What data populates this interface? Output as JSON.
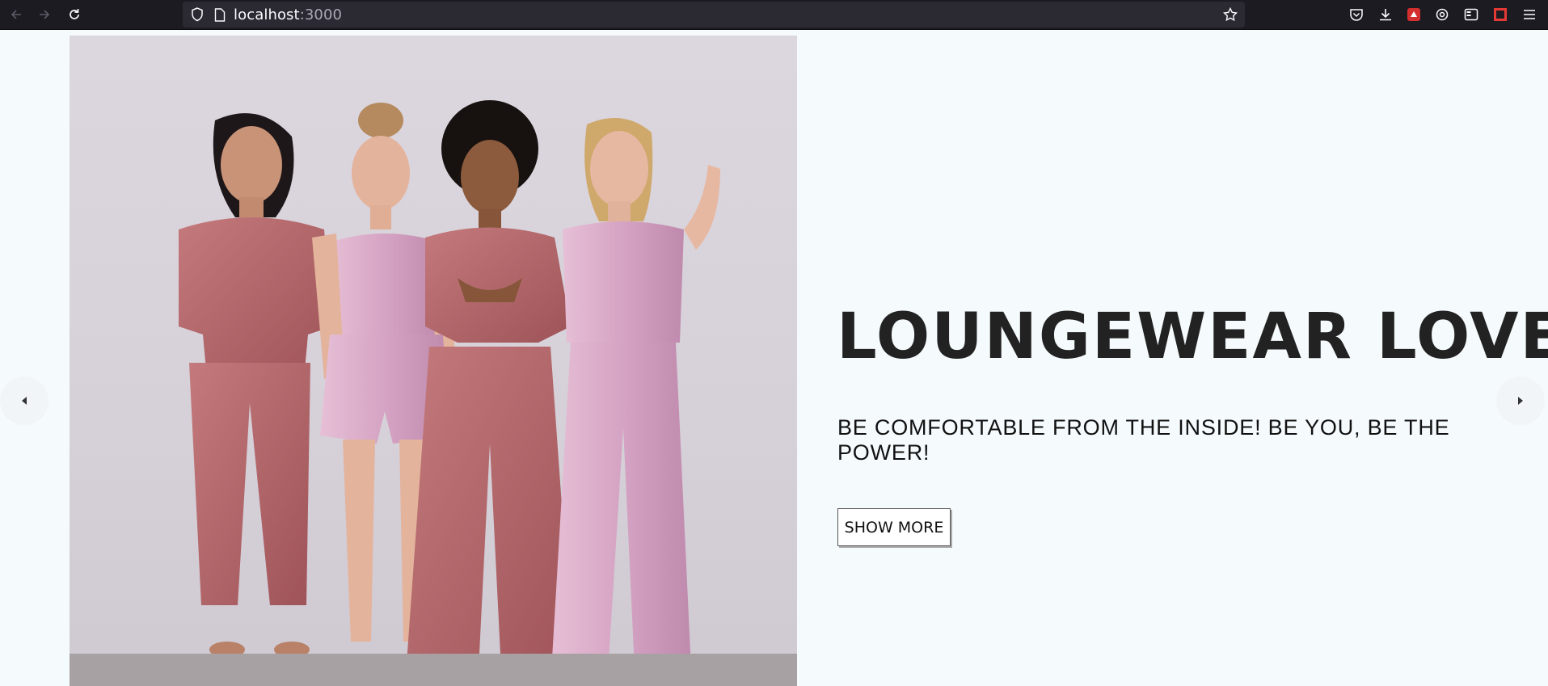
{
  "browser": {
    "url_host": "localhost",
    "url_port": ":3000",
    "icons": [
      "back-icon",
      "forward-icon",
      "reload-icon",
      "shield-icon",
      "page-icon",
      "bookmark-star-icon",
      "pocket-icon",
      "download-icon",
      "extension-icon",
      "sync-icon",
      "sidebar-icon",
      "extension-red-icon",
      "menu-icon"
    ]
  },
  "hero": {
    "title": "LOUNGEWEAR LOVE",
    "subtitle": "BE COMFORTABLE FROM THE INSIDE! BE YOU, BE THE POWER!",
    "button_label": "SHOW MORE",
    "image_icon": "loungewear-models-photo",
    "colors": {
      "background": "#f5fafc",
      "title": "#222222",
      "velvet": "#b86a6f",
      "satin": "#d7a8c8"
    }
  },
  "carousel": {
    "prev_icon": "caret-left-icon",
    "next_icon": "caret-right-icon"
  }
}
